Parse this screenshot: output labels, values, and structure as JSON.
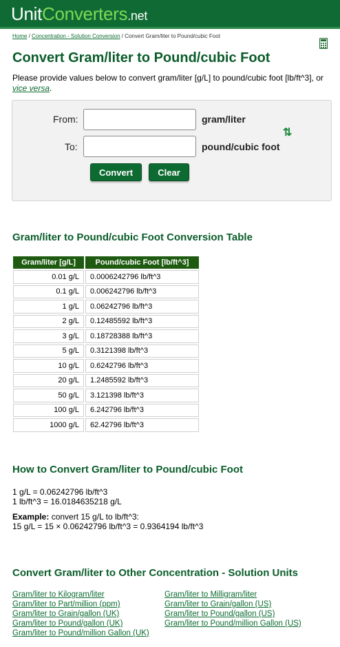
{
  "header": {
    "logo_unit": "Unit",
    "logo_converters": "Converters",
    "logo_net": ".net",
    "bg_color": "#0f6b33"
  },
  "breadcrumb": {
    "home": "Home",
    "sep1": " / ",
    "category": "Concentration - Solution Conversion",
    "sep2": " / ",
    "current": "Convert Gram/liter to Pound/cubic Foot"
  },
  "calculator_icon": "calculator-icon",
  "title": "Convert Gram/liter to Pound/cubic Foot",
  "intro": {
    "text": "Please provide values below to convert gram/liter [g/L] to pound/cubic foot [lb/ft^3], or ",
    "link": "vice versa",
    "end": "."
  },
  "converter": {
    "from_label": "From:",
    "from_value": "",
    "from_unit": "gram/liter",
    "to_label": "To:",
    "to_value": "",
    "to_unit": "pound/cubic foot",
    "swap_icon": "swap-arrows-icon",
    "convert_label": "Convert",
    "clear_label": "Clear"
  },
  "table_section": {
    "heading": "Gram/liter to Pound/cubic Foot Conversion Table",
    "col1": "Gram/liter [g/L]",
    "col2": "Pound/cubic Foot [lb/ft^3]",
    "rows": [
      [
        "0.01 g/L",
        "0.0006242796 lb/ft^3"
      ],
      [
        "0.1 g/L",
        "0.006242796 lb/ft^3"
      ],
      [
        "1 g/L",
        "0.06242796 lb/ft^3"
      ],
      [
        "2 g/L",
        "0.12485592 lb/ft^3"
      ],
      [
        "3 g/L",
        "0.18728388 lb/ft^3"
      ],
      [
        "5 g/L",
        "0.3121398 lb/ft^3"
      ],
      [
        "10 g/L",
        "0.6242796 lb/ft^3"
      ],
      [
        "20 g/L",
        "1.2485592 lb/ft^3"
      ],
      [
        "50 g/L",
        "3.121398 lb/ft^3"
      ],
      [
        "100 g/L",
        "6.242796 lb/ft^3"
      ],
      [
        "1000 g/L",
        "62.42796 lb/ft^3"
      ]
    ]
  },
  "howto": {
    "heading": "How to Convert Gram/liter to Pound/cubic Foot",
    "line1": "1 g/L = 0.06242796 lb/ft^3",
    "line2": "1 lb/ft^3 = 16.0184635218 g/L",
    "example_label": "Example:",
    "example_text": " convert 15 g/L to lb/ft^3:",
    "example_result": "15 g/L = 15 × 0.06242796 lb/ft^3 = 0.9364194 lb/ft^3"
  },
  "other_units": {
    "heading": "Convert Gram/liter to Other Concentration - Solution Units",
    "left": [
      "Gram/liter to Kilogram/liter",
      "Gram/liter to Part/million (ppm)",
      "Gram/liter to Grain/gallon (UK)",
      "Gram/liter to Pound/gallon (UK)",
      "Gram/liter to Pound/million Gallon (UK)"
    ],
    "right": [
      "Gram/liter to Milligram/liter",
      "Gram/liter to Grain/gallon (US)",
      "Gram/liter to Pound/gallon (US)",
      "Gram/liter to Pound/million Gallon (US)"
    ]
  }
}
